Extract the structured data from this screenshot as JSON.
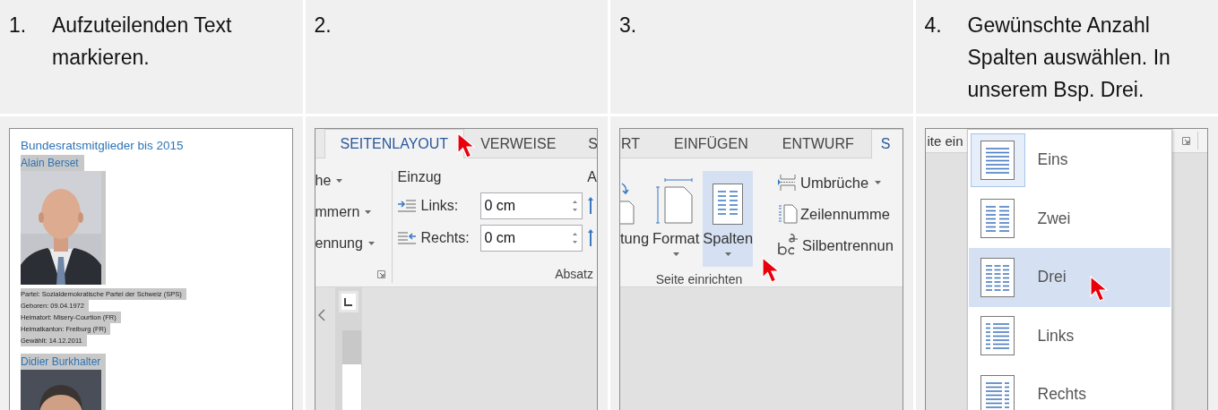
{
  "steps": [
    {
      "number": "1.",
      "text": "Aufzuteilenden Text markieren."
    },
    {
      "number": "2."
    },
    {
      "number": "3."
    },
    {
      "number": "4.",
      "text": "Gewünschte Anzahl Spalten auswählen. In unserem Bsp. Drei."
    }
  ],
  "panels": [
    {
      "kind": "document",
      "title": "Bundesratsmitglieder bis 2015",
      "entries": [
        {
          "name": "Alain Berset",
          "selected": true,
          "details": [
            {
              "text": "Partei: Sozialdemokratische Partei der Schweiz (SPS)",
              "selected": true
            },
            {
              "text": "Geboren: 09.04.1972",
              "selected": true
            },
            {
              "text": "Heimatort: Misery-Courtion (FR)",
              "selected": true
            },
            {
              "text": "Heimatkanton: Freiburg (FR)",
              "selected": true
            },
            {
              "text": "Gewählt: 14.12.2011",
              "selected": true
            }
          ]
        },
        {
          "name": "Didier Burkhalter",
          "selected": true
        }
      ]
    },
    {
      "kind": "paragraph_ribbon",
      "tabs": [
        {
          "label": "SEITENLAYOUT",
          "selected": true
        },
        {
          "label": "VERWEISE",
          "selected": false
        },
        {
          "label": "S",
          "selected": false
        }
      ],
      "left_items": [
        {
          "label": "he",
          "dropdown": true
        },
        {
          "label": "mmern",
          "dropdown": true
        },
        {
          "label": "ennung",
          "dropdown": true
        }
      ],
      "group_heading": "Einzug",
      "next_heading": "A",
      "indent_fields": [
        {
          "kind": "left",
          "label": "Links:",
          "value": "0 cm"
        },
        {
          "kind": "right",
          "label": "Rechts:",
          "value": "0 cm"
        }
      ],
      "group_label": "Absatz"
    },
    {
      "kind": "page_setup_ribbon",
      "tabs": [
        {
          "label": "RT",
          "selected": false
        },
        {
          "label": "EINFÜGEN",
          "selected": false
        },
        {
          "label": "ENTWURF",
          "selected": false
        },
        {
          "label": "S",
          "selected": true
        }
      ],
      "large_buttons": [
        {
          "kind": "orientation",
          "label": "tung",
          "dropdown": false,
          "highlighted": false
        },
        {
          "kind": "size",
          "label": "Format",
          "dropdown": true,
          "highlighted": false
        },
        {
          "kind": "columns",
          "label": "Spalten",
          "dropdown": true,
          "highlighted": true
        }
      ],
      "small_buttons": [
        {
          "kind": "breaks",
          "label": "Umbrüche",
          "dropdown": true
        },
        {
          "kind": "line_numbers",
          "label": "Zeilennumme",
          "dropdown": false
        },
        {
          "kind": "hyphenation",
          "label": "Silbentrennun",
          "dropdown": false
        }
      ],
      "group_label": "Seite einrichten"
    },
    {
      "kind": "columns_menu",
      "group_label": "ite ein",
      "items": [
        {
          "kind": "one",
          "label": "Eins",
          "current": true,
          "highlighted": false
        },
        {
          "kind": "two",
          "label": "Zwei",
          "current": false,
          "highlighted": false
        },
        {
          "kind": "three",
          "label": "Drei",
          "current": false,
          "highlighted": true
        },
        {
          "kind": "left",
          "label": "Links",
          "current": false,
          "highlighted": false
        },
        {
          "kind": "right",
          "label": "Rechts",
          "current": false,
          "highlighted": false
        }
      ]
    }
  ]
}
